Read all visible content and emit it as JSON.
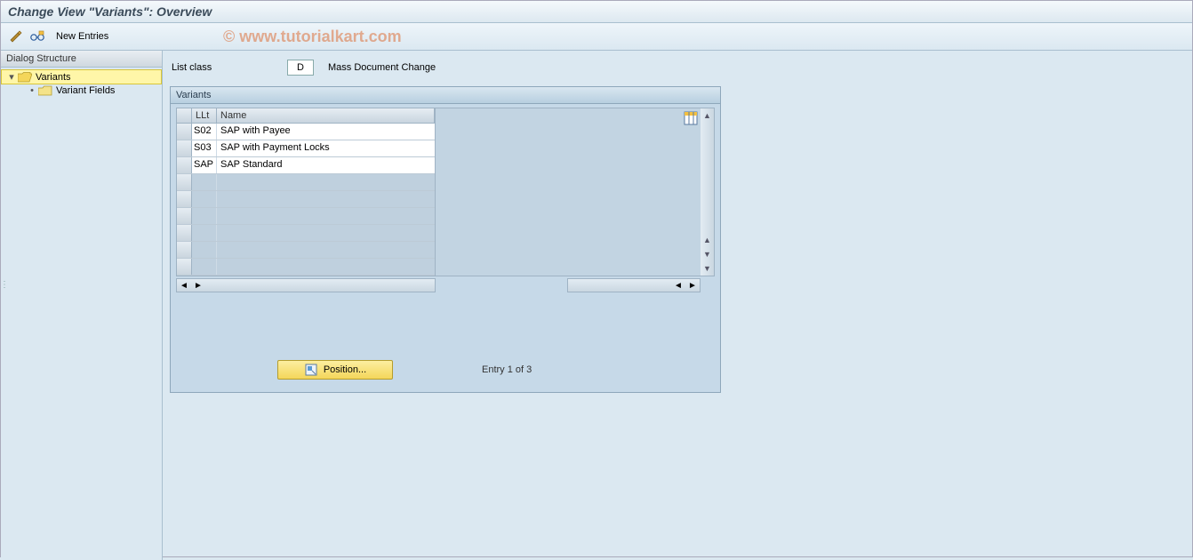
{
  "title": "Change View \"Variants\": Overview",
  "toolbar": {
    "new_entries": "New Entries"
  },
  "watermark": "© www.tutorialkart.com",
  "sidebar": {
    "header": "Dialog Structure",
    "items": [
      {
        "label": "Variants",
        "selected": true
      },
      {
        "label": "Variant Fields",
        "selected": false
      }
    ]
  },
  "fields": {
    "list_class_label": "List class",
    "list_class_value": "D",
    "list_class_desc": "Mass Document Change"
  },
  "panel": {
    "title": "Variants",
    "columns": {
      "sel": "",
      "llt": "LLt",
      "name": "Name"
    },
    "rows": [
      {
        "llt": "S02",
        "name": "SAP with Payee"
      },
      {
        "llt": "S03",
        "name": "SAP with Payment Locks"
      },
      {
        "llt": "SAP",
        "name": "SAP Standard"
      }
    ],
    "empty_rows": 6
  },
  "footer": {
    "position_label": "Position...",
    "entry_info": "Entry 1 of 3"
  }
}
